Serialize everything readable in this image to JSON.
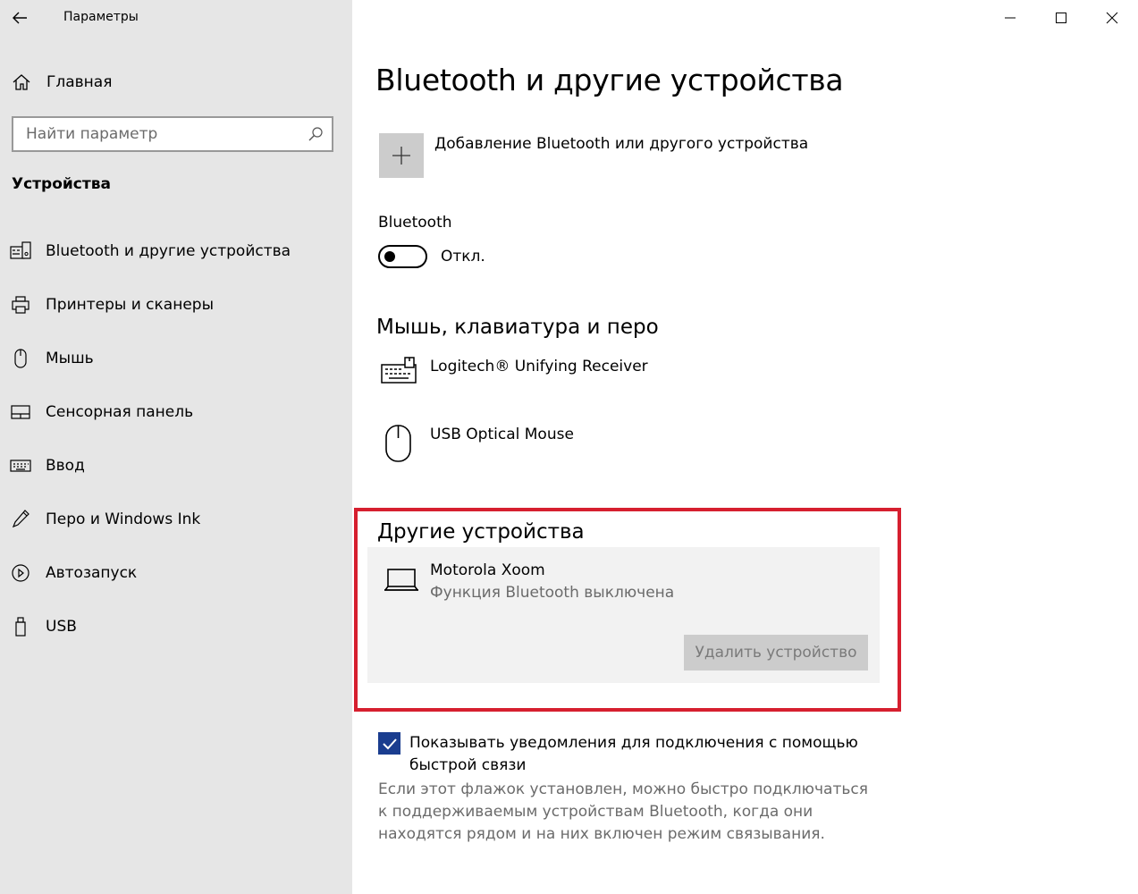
{
  "app": {
    "title": "Параметры"
  },
  "window_controls": {
    "minimize": "minimize-icon",
    "maximize": "maximize-icon",
    "close": "close-icon"
  },
  "sidebar": {
    "home_label": "Главная",
    "search": {
      "placeholder": "Найти параметр",
      "value": ""
    },
    "section_title": "Устройства",
    "items": [
      {
        "label": "Bluetooth и другие устройства",
        "icon": "bluetooth-devices-icon",
        "selected": true
      },
      {
        "label": "Принтеры и сканеры",
        "icon": "printer-icon"
      },
      {
        "label": "Мышь",
        "icon": "mouse-icon"
      },
      {
        "label": "Сенсорная панель",
        "icon": "touchpad-icon"
      },
      {
        "label": "Ввод",
        "icon": "keyboard-icon"
      },
      {
        "label": "Перо и Windows Ink",
        "icon": "pen-icon"
      },
      {
        "label": "Автозапуск",
        "icon": "autoplay-icon"
      },
      {
        "label": "USB",
        "icon": "usb-icon"
      }
    ]
  },
  "main": {
    "title": "Bluetooth и другие устройства",
    "add_device_label": "Добавление Bluetooth или другого устройства",
    "bluetooth": {
      "label": "Bluetooth",
      "state": "Откл.",
      "on": false
    },
    "groups": {
      "input": {
        "title": "Мышь, клавиатура и перо",
        "devices": [
          {
            "name": "Logitech® Unifying Receiver",
            "icon": "keyboard-icon"
          },
          {
            "name": "USB Optical Mouse",
            "icon": "mouse-icon"
          }
        ]
      },
      "other": {
        "title": "Другие устройства",
        "devices": [
          {
            "name": "Motorola Xoom",
            "status": "Функция Bluetooth выключена",
            "icon": "laptop-icon",
            "action": "Удалить устройство"
          }
        ]
      }
    },
    "swift_pair": {
      "checked": true,
      "label": "Показывать уведомления для подключения с помощью быстрой связи",
      "hint": "Если этот флажок установлен, можно быстро подключаться к поддерживаемым устройствам Bluetooth, когда они находятся рядом и на них включен режим связывания."
    }
  },
  "colors": {
    "sidebar_bg": "#e6e6e6",
    "highlight_border": "#d61f2f",
    "checkbox_fill": "#1a3d8f",
    "card_bg": "#f2f2f2",
    "button_bg": "#cccccc"
  }
}
